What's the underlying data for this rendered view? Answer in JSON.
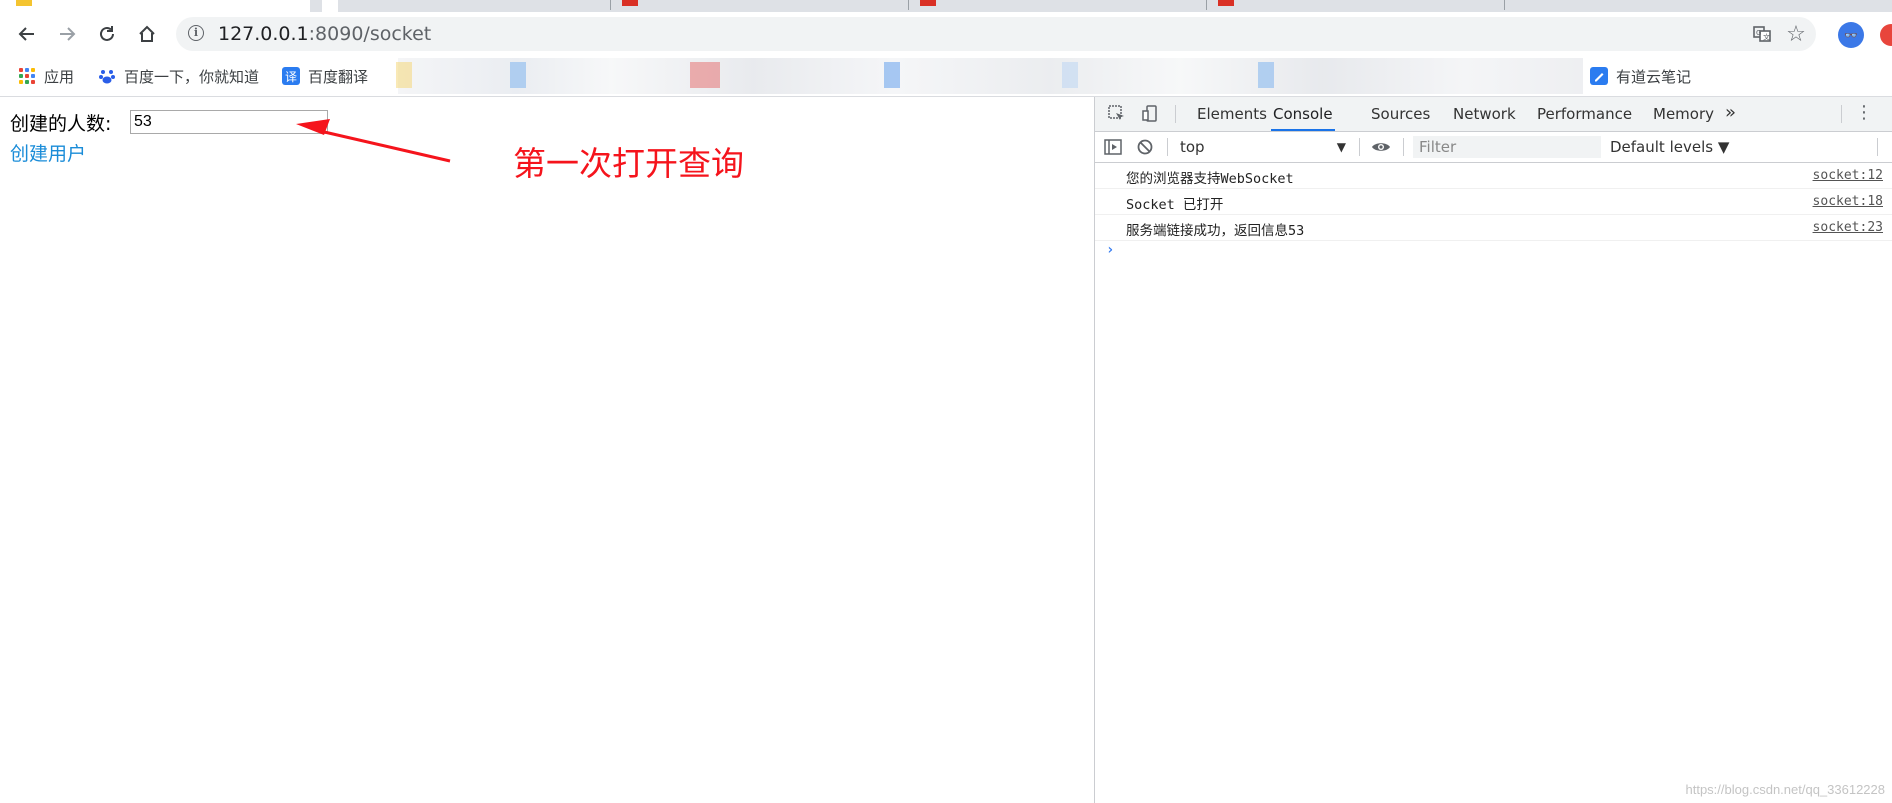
{
  "browser": {
    "url_host": "127.0.0.1",
    "url_rest": ":8090/socket",
    "bookmarks": [
      {
        "label": "应用",
        "icon": "apps-grid-icon"
      },
      {
        "label": "百度一下，你就知道",
        "icon": "baidu-paw-icon"
      },
      {
        "label": "百度翻译",
        "icon": "translate-badge-icon",
        "glyph": "译"
      },
      {
        "label": "有道云笔记",
        "icon": "youdao-note-icon"
      }
    ]
  },
  "page": {
    "count_label": "创建的人数:",
    "count_value": "53",
    "create_link": "创建用户",
    "annotation": "第一次打开查询",
    "annotation_color": "#f5141c"
  },
  "devtools": {
    "tabs": [
      "Elements",
      "Console",
      "Sources",
      "Network",
      "Performance",
      "Memory"
    ],
    "active_tab": "Console",
    "more_glyph": "»",
    "context": "top",
    "filter_placeholder": "Filter",
    "levels_label": "Default levels ▼",
    "logs": [
      {
        "message": "您的浏览器支持WebSocket",
        "source": "socket:12"
      },
      {
        "message": "Socket 已打开",
        "source": "socket:18"
      },
      {
        "message": "服务端链接成功，返回信息53",
        "source": "socket:23"
      }
    ],
    "prompt_glyph": "›"
  },
  "watermark": "https://blog.csdn.net/qq_33612228"
}
